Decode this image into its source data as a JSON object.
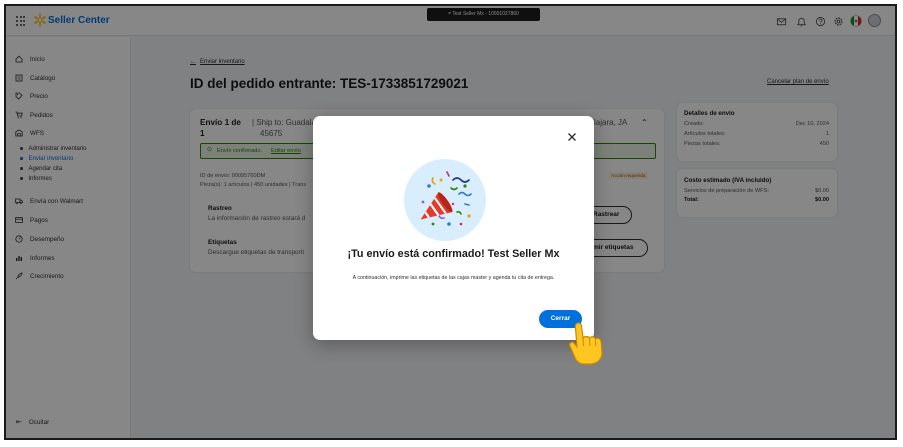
{
  "topbar": {
    "brand": "Seller Center",
    "environment": "= Test Seller Mx - 10001027860",
    "icons": [
      "grid-icon",
      "spark-logo-icon",
      "mail-icon",
      "bell-icon",
      "help-icon",
      "settings-icon",
      "mexico-flag-icon",
      "avatar"
    ]
  },
  "sidebar": {
    "items": [
      {
        "label": "Inicio",
        "icon": "home-icon"
      },
      {
        "label": "Catálogo",
        "icon": "catalog-icon"
      },
      {
        "label": "Precio",
        "icon": "tag-icon"
      },
      {
        "label": "Pedidos",
        "icon": "cart-icon"
      },
      {
        "label": "WFS",
        "icon": "warehouse-icon"
      }
    ],
    "wfs_subitems": [
      {
        "label": "Administrar inventario",
        "active": false
      },
      {
        "label": "Enviar inventario",
        "active": true
      },
      {
        "label": "Agendar cita",
        "active": false
      },
      {
        "label": "Informes",
        "active": false
      }
    ],
    "lower_items": [
      {
        "label": "Envía con Walmart",
        "icon": "truck-icon"
      },
      {
        "label": "Pagos",
        "icon": "card-icon"
      },
      {
        "label": "Desempeño",
        "icon": "gauge-icon"
      },
      {
        "label": "Informes",
        "icon": "bar-chart-icon"
      },
      {
        "label": "Crecimiento",
        "icon": "rocket-icon"
      }
    ],
    "hide_label": "Ocultar"
  },
  "main": {
    "back_link": "Enviar inventario",
    "title": "ID del pedido entrante: TES-1733851729021",
    "cancel_link": "Cancelar plan de envío",
    "shipment": {
      "heading_a": "Envío 1 de",
      "heading_b": "1",
      "ship_to": "| Ship to: Guadalajara",
      "destination_tail": "lajara, JA",
      "zip": "45675",
      "confirm_text": "Envío confirmado.",
      "edit_link": "Editar envío",
      "shipment_id": "ID de envío: 00095760DM",
      "pieces": "Pieza(s): 1 artículos | 450 unidades | Trans",
      "action_badge": "Acción requerida",
      "tracking_title": "Rastreo",
      "tracking_text": "La información de rastreo estará d",
      "track_button": "Rastrear",
      "labels_title": "Etiquetas",
      "labels_text": "Descargue etiquetas de transporti",
      "print_button": "mir etiquetas"
    },
    "details": {
      "title": "Detalles de envío",
      "rows": [
        {
          "k": "Creado:",
          "v": "Dec 10, 2024"
        },
        {
          "k": "Artículos totales:",
          "v": "1"
        },
        {
          "k": "Piezas totales:",
          "v": "450"
        }
      ]
    },
    "cost": {
      "title": "Costo estimado (IVA incluido)",
      "service_label": "Servicios de preparación de WFS:",
      "service_value": "$0.00",
      "total_label": "Total:",
      "total_value": "$0.00"
    }
  },
  "modal": {
    "heading": "¡Tu envío está confirmado! Test Seller Mx",
    "text": "A continuación, imprime las etiquetas de las cajas master y agenda tu cita de entrega.",
    "close_button": "Cerrar",
    "close_icon": "close-icon",
    "illustration": "party-popper-icon"
  },
  "colors": {
    "brand_blue": "#0071dc",
    "spark_yellow": "#ffc220",
    "success_green": "#2a8703",
    "overlay": "rgba(0,0,0,0.47)"
  }
}
